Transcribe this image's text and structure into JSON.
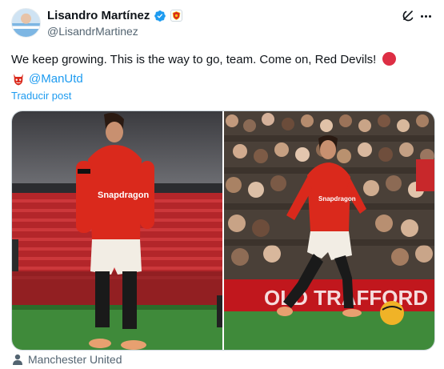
{
  "post": {
    "author": {
      "display_name": "Lisandro Martínez",
      "handle": "@LisandrMartinez",
      "verified": true,
      "affiliate_badge": "manutd-crest-icon"
    },
    "text_line1": "We keep growing. This is the way to go, team. Come on, Red Devils!",
    "text_line2_mention": "@ManUtd",
    "emoji_line1": "red-circle-icon",
    "emoji_line2": "red-devil-icon",
    "translate_label": "Traducir post",
    "media_count": 2,
    "location": "Manchester United"
  },
  "icons": {
    "header_action_1": "grok-icon",
    "header_action_2": "more-icon",
    "location": "person-icon"
  },
  "colors": {
    "accent": "#1d9bf0",
    "text": "#0f1419",
    "muted": "#536471",
    "united_red": "#da291c"
  }
}
